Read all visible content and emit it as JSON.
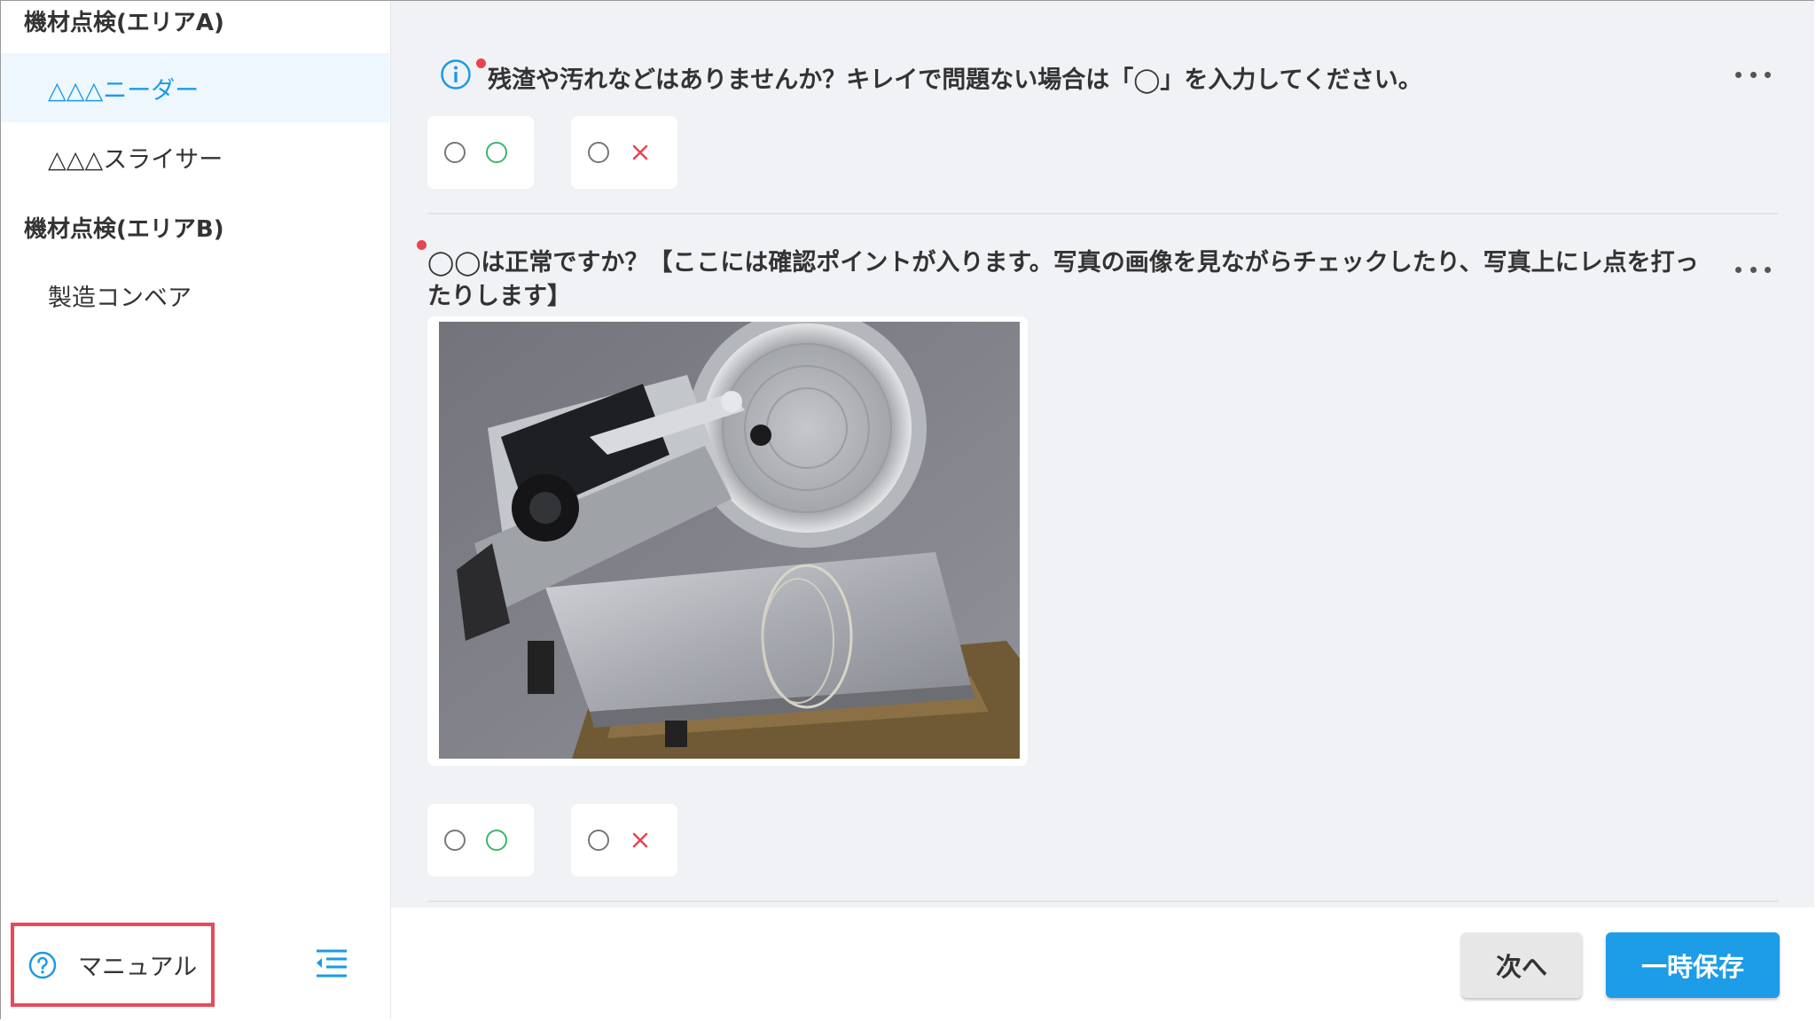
{
  "sidebar": {
    "groups": [
      {
        "title": "機材点検(エリアA)",
        "items": [
          "△△△ニーダー",
          "△△△スライサー"
        ]
      },
      {
        "title": "機材点検(エリアB)",
        "items": [
          "製造コンベア"
        ]
      }
    ],
    "active_item": "△△△ニーダー",
    "manual_label": "マニュアル"
  },
  "questions": [
    {
      "text": "残渣や汚れなどはありませんか？キレイで問題ない場合は「◯」を入力してください。",
      "required": true,
      "has_info_icon": true,
      "choices": [
        {
          "icon": "circle-mark-icon",
          "meaning": "ok"
        },
        {
          "icon": "cross-mark-icon",
          "meaning": "ng"
        }
      ]
    },
    {
      "text_line1": "◯◯は正常ですか？【ここには確認ポイントが入ります。写真の画像を見ながらチェックしたり、写真上にレ点を打っ",
      "text_line2": "たりします】",
      "required": true,
      "image": "meat-slicer-photo",
      "choices": [
        {
          "icon": "circle-mark-icon",
          "meaning": "ok"
        },
        {
          "icon": "cross-mark-icon",
          "meaning": "ng"
        }
      ]
    }
  ],
  "footer": {
    "next_label": "次へ",
    "save_label": "一時保存"
  },
  "colors": {
    "accent": "#1d9ce8",
    "required_dot": "#e8434f",
    "ok_mark": "#3bb56c",
    "ng_mark": "#e8434f",
    "highlight_border": "#e84a5a",
    "main_bg": "#f0f2f5"
  }
}
